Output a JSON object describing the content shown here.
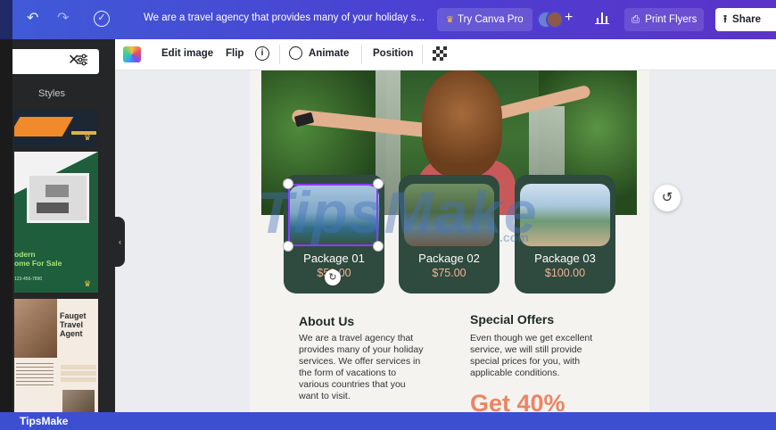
{
  "topbar": {
    "undo_icon": "undo-icon",
    "redo_icon": "redo-icon",
    "save_status_icon": "cloud-check-icon",
    "document_title": "We are a travel agency that provides many of your holiday s...",
    "try_pro_label": "Try Canva Pro",
    "add_collaborator_label": "+",
    "print_label": "Print Flyers",
    "share_label": "Share"
  },
  "toolbar": {
    "edit_image_label": "Edit image",
    "flip_label": "Flip",
    "info_label": "i",
    "animate_label": "Animate",
    "position_label": "Position"
  },
  "sidebar": {
    "styles_label": "Styles",
    "search_value": "",
    "templates": [
      {
        "name": "Modern Home For Sale",
        "heading": "odern",
        "subheading": "ome For Sale",
        "phone": "123-456-7890"
      },
      {
        "name": "Fauget Travel Agent",
        "heading": "Fauget\nTravel\nAgent"
      }
    ]
  },
  "design": {
    "packages": [
      {
        "name": "Package 01",
        "price": "$50.00"
      },
      {
        "name": "Package 02",
        "price": "$75.00"
      },
      {
        "name": "Package 03",
        "price": "$100.00"
      }
    ],
    "about": {
      "title": "About Us",
      "lines": [
        "We are a travel agency that",
        "provides many of your holiday",
        "services. We offer services in",
        "the form of vacations to",
        "various countries that you",
        "want to visit."
      ]
    },
    "offers": {
      "title": "Special Offers",
      "lines": [
        "Even though we get excellent",
        "service, we will still provide",
        "special prices for you, with",
        "applicable conditions."
      ],
      "headline": "Get 40%"
    }
  },
  "watermark": {
    "text": "TipsMake",
    "suffix": ".com"
  },
  "footer": {
    "text": "TipsMake"
  },
  "colors": {
    "topbar_accent": "#4c3fd1",
    "card_green": "#2f4a3f",
    "price_peach": "#f3b191",
    "offer_orange": "#ec8563",
    "selection_purple": "#8b3dff"
  }
}
